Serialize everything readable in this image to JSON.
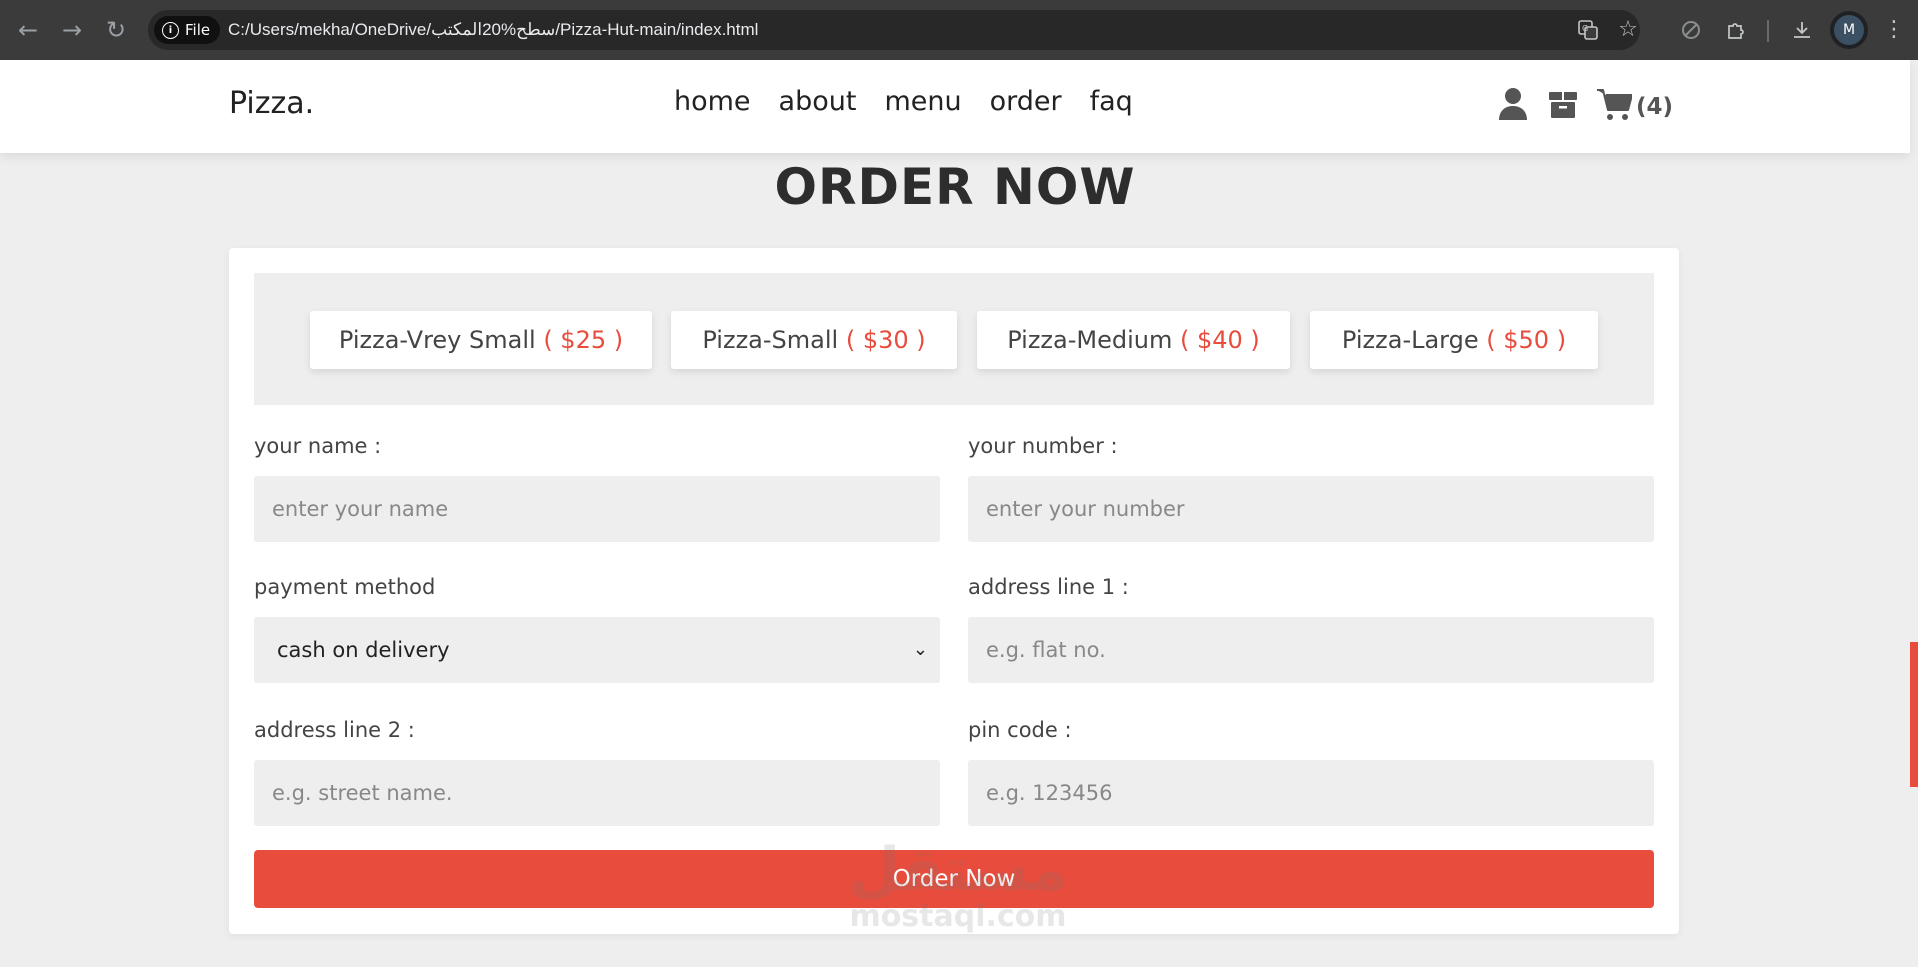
{
  "browser": {
    "file_label": "File",
    "url": "C:/Users/mekha/OneDrive/سطح%20المكتب/Pizza-Hut-main/index.html",
    "profile_initial": "M"
  },
  "header": {
    "logo": "Pizza.",
    "nav": [
      "home",
      "about",
      "menu",
      "order",
      "faq"
    ],
    "cart_count": "(4)"
  },
  "order": {
    "title": "ORDER NOW",
    "sizes": [
      {
        "name": "Pizza-Vrey Small",
        "price": "( $25 )"
      },
      {
        "name": "Pizza-Small",
        "price": "( $30 )"
      },
      {
        "name": "Pizza-Medium",
        "price": "( $40 )"
      },
      {
        "name": "Pizza-Large",
        "price": "( $50 )"
      }
    ],
    "fields": {
      "name": {
        "label": "your name :",
        "placeholder": "enter your name"
      },
      "number": {
        "label": "your number :",
        "placeholder": "enter your number"
      },
      "payment": {
        "label": "payment method",
        "value": "cash on delivery"
      },
      "address1": {
        "label": "address line 1 :",
        "placeholder": "e.g. flat no."
      },
      "address2": {
        "label": "address line 2 :",
        "placeholder": "e.g. street name."
      },
      "pin": {
        "label": "pin code :",
        "placeholder": "e.g. 123456"
      }
    },
    "submit_label": "Order Now"
  },
  "watermark": {
    "arabic": "مستقل",
    "latin": "mostaql.com"
  },
  "colors": {
    "accent": "#e74c3c",
    "chrome": "#3b3b3b"
  }
}
